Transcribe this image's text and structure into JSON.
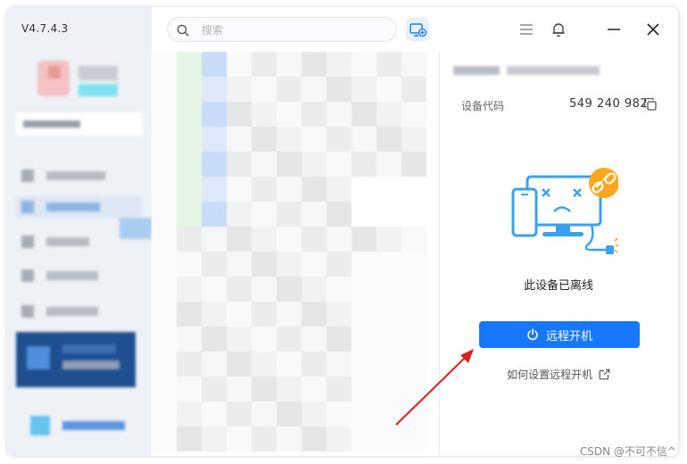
{
  "app": {
    "version": "V4.7.4.3"
  },
  "search": {
    "placeholder": "搜索"
  },
  "window_controls": {
    "menu_icon": "hamburger-menu-icon",
    "bell_icon": "bell-icon",
    "minimize_icon": "minimize-icon",
    "close_icon": "close-icon"
  },
  "device_detail": {
    "code_label": "设备代码",
    "code_value": "549 240 982",
    "status_text": "此设备已离线",
    "wake_button_label": "远程开机",
    "help_link_label": "如何设置远程开机"
  },
  "watermark": "CSDN @不可不信^",
  "colors": {
    "accent": "#1677ff",
    "sidebar_bg": "#eef1f6",
    "illustration_blue": "#3aa0f2",
    "link_badge": "#ffa81d",
    "arrow": "#e02020"
  }
}
